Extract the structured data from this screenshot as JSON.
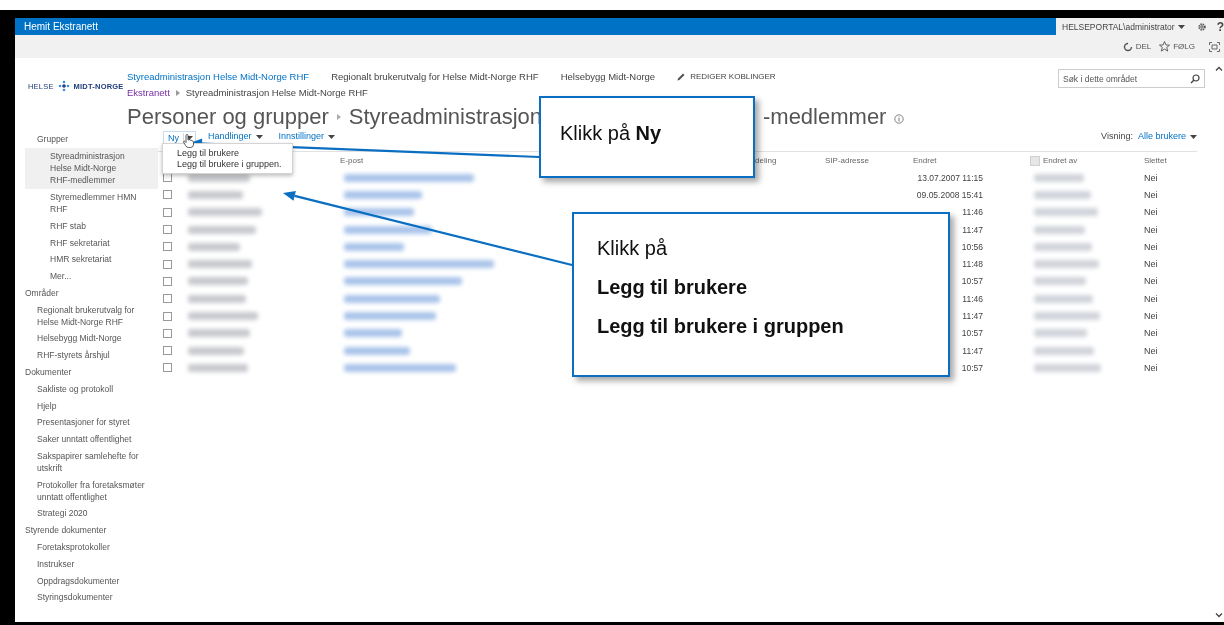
{
  "suite_bar": {
    "title": "Hemit Ekstranett",
    "user": "HELSEPORTAL\\administrator",
    "help": "?"
  },
  "ribbon": {
    "actions": [
      {
        "kind": "share",
        "label": "DEL"
      },
      {
        "kind": "follow",
        "label": "FØLG"
      }
    ]
  },
  "logo": {
    "left": "HELSE",
    "right": "MIDT-NORGE"
  },
  "top_nav": {
    "links": [
      {
        "label": "Styreadministrasjon Helse Midt-Norge RHF",
        "selected": true
      },
      {
        "label": "Regionalt brukerutvalg for Helse Midt-Norge RHF",
        "selected": false
      },
      {
        "label": "Helsebygg Midt-Norge",
        "selected": false
      }
    ],
    "edit_links": "REDIGER KOBLINGER"
  },
  "search": {
    "placeholder": "Søk i dette området"
  },
  "breadcrumb": [
    "Ekstranett",
    "Styreadministrasjon Helse Midt-Norge RHF"
  ],
  "title": {
    "parts": [
      "Personer og grupper",
      "Styreadministrasjon",
      "-medlemmer"
    ]
  },
  "sidebar": {
    "groups": {
      "label": "Grupper",
      "children": [
        {
          "label": "Styreadministrasjon Helse Midt-Norge RHF-medlemmer",
          "selected": true
        },
        {
          "label": "Styremedlemmer HMN RHF",
          "selected": false
        },
        {
          "label": "RHF stab",
          "selected": false
        },
        {
          "label": "RHF sekretariat",
          "selected": false
        },
        {
          "label": "HMR sekretariat",
          "selected": false
        },
        {
          "label": "Mer...",
          "selected": false
        }
      ]
    },
    "sections": [
      {
        "label": "Områder",
        "children": [
          {
            "label": "Regionalt brukerutvalg for Helse Midt-Norge RHF",
            "selected": false
          },
          {
            "label": "Helsebygg Midt-Norge",
            "selected": false
          },
          {
            "label": "RHF-styrets årshjul",
            "selected": false
          }
        ]
      },
      {
        "label": "Dokumenter",
        "children": [
          {
            "label": "Sakliste og protokoll",
            "selected": false
          },
          {
            "label": "Hjelp",
            "selected": false
          },
          {
            "label": "Presentasjoner for styret",
            "selected": false
          },
          {
            "label": "Saker unntatt offentlighet",
            "selected": false
          },
          {
            "label": "Sakspapirer samlehefte for utskrift",
            "selected": false
          },
          {
            "label": "Protokoller fra foretaksmøter unntatt offentlighet",
            "selected": false
          },
          {
            "label": "Strategi 2020",
            "selected": false
          }
        ]
      },
      {
        "label": "Styrende dokumenter",
        "children": [
          {
            "label": "Foretaksprotokoller",
            "selected": false
          },
          {
            "label": "Instrukser",
            "selected": false
          },
          {
            "label": "Oppdragsdokumenter",
            "selected": false
          },
          {
            "label": "Styringsdokumenter",
            "selected": false
          }
        ]
      }
    ]
  },
  "toolbar": {
    "buttons": [
      {
        "kind": "split",
        "label": "Ny"
      },
      {
        "kind": "menu",
        "label": "Handlinger"
      },
      {
        "kind": "menu",
        "label": "Innstillinger"
      }
    ]
  },
  "new_menu": {
    "title": "Legg til brukere",
    "description": "Legg til brukere i gruppen."
  },
  "view": {
    "label": "Visning:",
    "value": "Alle brukere"
  },
  "table": {
    "columns": [
      {
        "kind": "text",
        "label": "E-post"
      },
      {
        "kind": "text",
        "label": "deling"
      },
      {
        "kind": "text",
        "label": "SIP-adresse"
      },
      {
        "kind": "text",
        "label": "Endret"
      },
      {
        "kind": "icon",
        "label": "Endret av"
      },
      {
        "kind": "text",
        "label": "Slettet"
      }
    ],
    "rows": [
      {
        "checked": false,
        "changed": "13.07.2007 11:15",
        "deleted": "Nei"
      },
      {
        "checked": false,
        "changed": "09.05.2008 15:41",
        "deleted": "Nei"
      },
      {
        "checked": false,
        "changed": "11:46",
        "deleted": "Nei"
      },
      {
        "checked": false,
        "changed": "11:47",
        "deleted": "Nei"
      },
      {
        "checked": false,
        "changed": "10:56",
        "deleted": "Nei"
      },
      {
        "checked": false,
        "changed": "11:48",
        "deleted": "Nei"
      },
      {
        "checked": false,
        "changed": "10:57",
        "deleted": "Nei"
      },
      {
        "checked": false,
        "changed": "11:46",
        "deleted": "Nei"
      },
      {
        "checked": false,
        "changed": "11:47",
        "deleted": "Nei"
      },
      {
        "checked": false,
        "changed": "10:57",
        "deleted": "Nei"
      },
      {
        "checked": false,
        "changed": "11:47",
        "deleted": "Nei"
      },
      {
        "checked": false,
        "changed": "10:57",
        "deleted": "Nei"
      }
    ]
  },
  "callouts": [
    {
      "kind": "sentence",
      "text": "Klikk på **Ny**"
    },
    {
      "kind": "lines",
      "lines": [
        {
          "text": "Klikk på",
          "bold": false
        },
        {
          "text": "Legg til brukere",
          "bold": true
        },
        {
          "text": "Legg til brukere i gruppen",
          "bold": true
        }
      ]
    }
  ]
}
